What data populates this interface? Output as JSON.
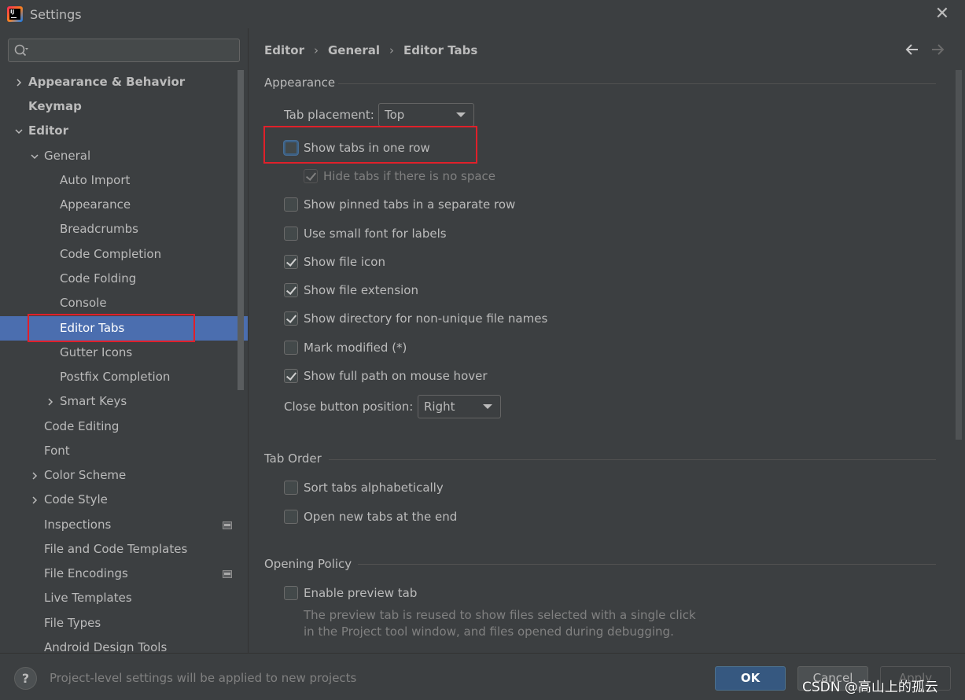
{
  "window": {
    "title": "Settings",
    "close_symbol": "✕"
  },
  "sidebar": {
    "search": {
      "placeholder": "",
      "value": ""
    },
    "items": [
      {
        "label": "Appearance & Behavior",
        "bold": true,
        "arrow": "right"
      },
      {
        "label": "Keymap",
        "bold": true
      },
      {
        "label": "Editor",
        "bold": true,
        "arrow": "down"
      },
      {
        "label": "General",
        "arrow": "down"
      },
      {
        "label": "Auto Import"
      },
      {
        "label": "Appearance"
      },
      {
        "label": "Breadcrumbs"
      },
      {
        "label": "Code Completion"
      },
      {
        "label": "Code Folding"
      },
      {
        "label": "Console"
      },
      {
        "label": "Editor Tabs",
        "selected": true
      },
      {
        "label": "Gutter Icons"
      },
      {
        "label": "Postfix Completion"
      },
      {
        "label": "Smart Keys",
        "arrow": "right"
      },
      {
        "label": "Code Editing"
      },
      {
        "label": "Font"
      },
      {
        "label": "Color Scheme",
        "arrow": "right"
      },
      {
        "label": "Code Style",
        "arrow": "right"
      },
      {
        "label": "Inspections",
        "project_icon": true
      },
      {
        "label": "File and Code Templates"
      },
      {
        "label": "File Encodings",
        "project_icon": true
      },
      {
        "label": "Live Templates"
      },
      {
        "label": "File Types"
      },
      {
        "label": "Android Design Tools"
      }
    ]
  },
  "main": {
    "breadcrumb": [
      "Editor",
      "General",
      "Editor Tabs"
    ],
    "breadcrumb_separator": "›",
    "sections": {
      "appearance": {
        "title": "Appearance",
        "tab_placement_label": "Tab placement:",
        "tab_placement_value": "Top",
        "options": [
          {
            "label": "Show tabs in one row",
            "checked": false,
            "focused": true
          },
          {
            "label": "Hide tabs if there is no space",
            "checked": true,
            "disabled": true
          },
          {
            "label": "Show pinned tabs in a separate row",
            "checked": false
          },
          {
            "label": "Use small font for labels",
            "checked": false
          },
          {
            "label": "Show file icon",
            "checked": true
          },
          {
            "label": "Show file extension",
            "checked": true
          },
          {
            "label": "Show directory for non-unique file names",
            "checked": true
          },
          {
            "label": "Mark modified (*)",
            "checked": false
          },
          {
            "label": "Show full path on mouse hover",
            "checked": true
          }
        ],
        "close_button_label": "Close button position:",
        "close_button_value": "Right"
      },
      "tab_order": {
        "title": "Tab Order",
        "options": [
          {
            "label": "Sort tabs alphabetically",
            "checked": false
          },
          {
            "label": "Open new tabs at the end",
            "checked": false
          }
        ]
      },
      "opening_policy": {
        "title": "Opening Policy",
        "options": [
          {
            "label": "Enable preview tab",
            "checked": false
          }
        ],
        "help_line1": "The preview tab is reused to show files selected with a single click",
        "help_line2": "in the Project tool window, and files opened during debugging."
      }
    }
  },
  "footer": {
    "help_label": "?",
    "note": "Project-level settings will be applied to new projects",
    "ok_label": "OK",
    "cancel_label": "Cancel",
    "apply_label": "Apply",
    "watermark": "CSDN @高山上的孤云"
  },
  "colors": {
    "background": "#3c3f41",
    "selection": "#4b6eaf",
    "highlight_box": "#e0202a",
    "ok_button": "#365880"
  }
}
